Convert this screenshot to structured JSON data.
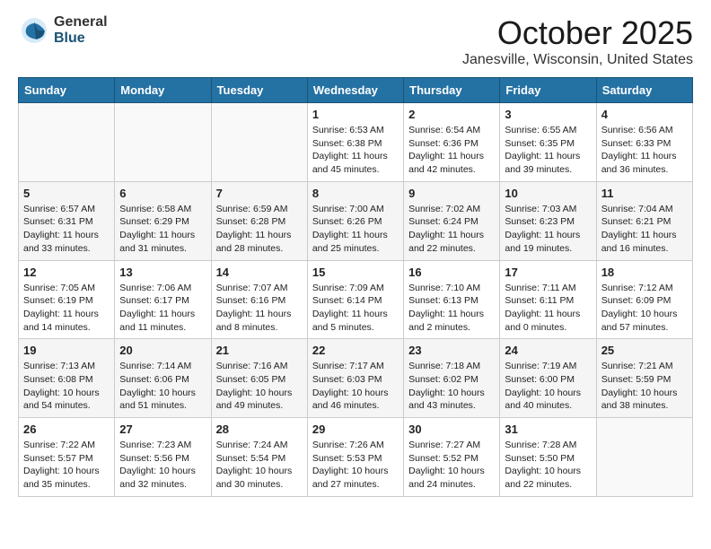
{
  "header": {
    "logo_general": "General",
    "logo_blue": "Blue",
    "month_title": "October 2025",
    "location": "Janesville, Wisconsin, United States"
  },
  "weekdays": [
    "Sunday",
    "Monday",
    "Tuesday",
    "Wednesday",
    "Thursday",
    "Friday",
    "Saturday"
  ],
  "weeks": [
    [
      {
        "day": "",
        "content": ""
      },
      {
        "day": "",
        "content": ""
      },
      {
        "day": "",
        "content": ""
      },
      {
        "day": "1",
        "content": "Sunrise: 6:53 AM\nSunset: 6:38 PM\nDaylight: 11 hours and 45 minutes."
      },
      {
        "day": "2",
        "content": "Sunrise: 6:54 AM\nSunset: 6:36 PM\nDaylight: 11 hours and 42 minutes."
      },
      {
        "day": "3",
        "content": "Sunrise: 6:55 AM\nSunset: 6:35 PM\nDaylight: 11 hours and 39 minutes."
      },
      {
        "day": "4",
        "content": "Sunrise: 6:56 AM\nSunset: 6:33 PM\nDaylight: 11 hours and 36 minutes."
      }
    ],
    [
      {
        "day": "5",
        "content": "Sunrise: 6:57 AM\nSunset: 6:31 PM\nDaylight: 11 hours and 33 minutes."
      },
      {
        "day": "6",
        "content": "Sunrise: 6:58 AM\nSunset: 6:29 PM\nDaylight: 11 hours and 31 minutes."
      },
      {
        "day": "7",
        "content": "Sunrise: 6:59 AM\nSunset: 6:28 PM\nDaylight: 11 hours and 28 minutes."
      },
      {
        "day": "8",
        "content": "Sunrise: 7:00 AM\nSunset: 6:26 PM\nDaylight: 11 hours and 25 minutes."
      },
      {
        "day": "9",
        "content": "Sunrise: 7:02 AM\nSunset: 6:24 PM\nDaylight: 11 hours and 22 minutes."
      },
      {
        "day": "10",
        "content": "Sunrise: 7:03 AM\nSunset: 6:23 PM\nDaylight: 11 hours and 19 minutes."
      },
      {
        "day": "11",
        "content": "Sunrise: 7:04 AM\nSunset: 6:21 PM\nDaylight: 11 hours and 16 minutes."
      }
    ],
    [
      {
        "day": "12",
        "content": "Sunrise: 7:05 AM\nSunset: 6:19 PM\nDaylight: 11 hours and 14 minutes."
      },
      {
        "day": "13",
        "content": "Sunrise: 7:06 AM\nSunset: 6:17 PM\nDaylight: 11 hours and 11 minutes."
      },
      {
        "day": "14",
        "content": "Sunrise: 7:07 AM\nSunset: 6:16 PM\nDaylight: 11 hours and 8 minutes."
      },
      {
        "day": "15",
        "content": "Sunrise: 7:09 AM\nSunset: 6:14 PM\nDaylight: 11 hours and 5 minutes."
      },
      {
        "day": "16",
        "content": "Sunrise: 7:10 AM\nSunset: 6:13 PM\nDaylight: 11 hours and 2 minutes."
      },
      {
        "day": "17",
        "content": "Sunrise: 7:11 AM\nSunset: 6:11 PM\nDaylight: 11 hours and 0 minutes."
      },
      {
        "day": "18",
        "content": "Sunrise: 7:12 AM\nSunset: 6:09 PM\nDaylight: 10 hours and 57 minutes."
      }
    ],
    [
      {
        "day": "19",
        "content": "Sunrise: 7:13 AM\nSunset: 6:08 PM\nDaylight: 10 hours and 54 minutes."
      },
      {
        "day": "20",
        "content": "Sunrise: 7:14 AM\nSunset: 6:06 PM\nDaylight: 10 hours and 51 minutes."
      },
      {
        "day": "21",
        "content": "Sunrise: 7:16 AM\nSunset: 6:05 PM\nDaylight: 10 hours and 49 minutes."
      },
      {
        "day": "22",
        "content": "Sunrise: 7:17 AM\nSunset: 6:03 PM\nDaylight: 10 hours and 46 minutes."
      },
      {
        "day": "23",
        "content": "Sunrise: 7:18 AM\nSunset: 6:02 PM\nDaylight: 10 hours and 43 minutes."
      },
      {
        "day": "24",
        "content": "Sunrise: 7:19 AM\nSunset: 6:00 PM\nDaylight: 10 hours and 40 minutes."
      },
      {
        "day": "25",
        "content": "Sunrise: 7:21 AM\nSunset: 5:59 PM\nDaylight: 10 hours and 38 minutes."
      }
    ],
    [
      {
        "day": "26",
        "content": "Sunrise: 7:22 AM\nSunset: 5:57 PM\nDaylight: 10 hours and 35 minutes."
      },
      {
        "day": "27",
        "content": "Sunrise: 7:23 AM\nSunset: 5:56 PM\nDaylight: 10 hours and 32 minutes."
      },
      {
        "day": "28",
        "content": "Sunrise: 7:24 AM\nSunset: 5:54 PM\nDaylight: 10 hours and 30 minutes."
      },
      {
        "day": "29",
        "content": "Sunrise: 7:26 AM\nSunset: 5:53 PM\nDaylight: 10 hours and 27 minutes."
      },
      {
        "day": "30",
        "content": "Sunrise: 7:27 AM\nSunset: 5:52 PM\nDaylight: 10 hours and 24 minutes."
      },
      {
        "day": "31",
        "content": "Sunrise: 7:28 AM\nSunset: 5:50 PM\nDaylight: 10 hours and 22 minutes."
      },
      {
        "day": "",
        "content": ""
      }
    ]
  ]
}
